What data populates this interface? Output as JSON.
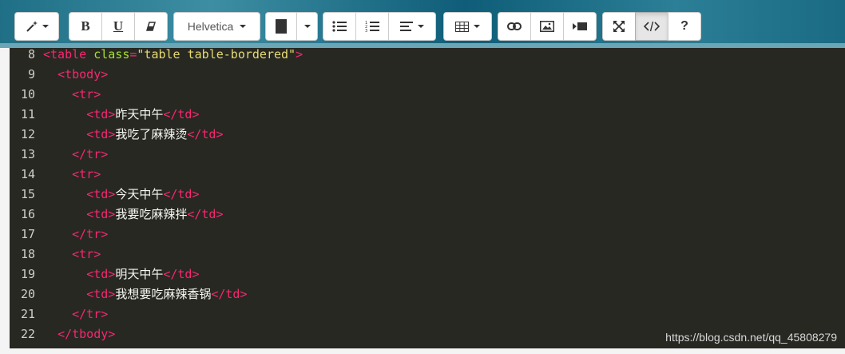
{
  "toolbar": {
    "font_name": "Helvetica",
    "bold_label": "B",
    "underline_label": "U",
    "help_label": "?"
  },
  "editor": {
    "lines": [
      {
        "n": "8",
        "indent": "",
        "parts": [
          {
            "t": "tag",
            "v": "<table "
          },
          {
            "t": "attr",
            "v": "class"
          },
          {
            "t": "tag",
            "v": "="
          },
          {
            "t": "str",
            "v": "\"table table-bordered\""
          },
          {
            "t": "tag",
            "v": ">"
          }
        ]
      },
      {
        "n": "9",
        "indent": "  ",
        "parts": [
          {
            "t": "tag",
            "v": "<tbody>"
          }
        ]
      },
      {
        "n": "10",
        "indent": "    ",
        "parts": [
          {
            "t": "tag",
            "v": "<tr>"
          }
        ]
      },
      {
        "n": "11",
        "indent": "      ",
        "parts": [
          {
            "t": "tag",
            "v": "<td>"
          },
          {
            "t": "txt",
            "v": "昨天中午"
          },
          {
            "t": "tag",
            "v": "</td>"
          }
        ]
      },
      {
        "n": "12",
        "indent": "      ",
        "parts": [
          {
            "t": "tag",
            "v": "<td>"
          },
          {
            "t": "txt",
            "v": "我吃了麻辣烫"
          },
          {
            "t": "tag",
            "v": "</td>"
          }
        ]
      },
      {
        "n": "13",
        "indent": "    ",
        "parts": [
          {
            "t": "tag",
            "v": "</tr>"
          }
        ]
      },
      {
        "n": "14",
        "indent": "    ",
        "parts": [
          {
            "t": "tag",
            "v": "<tr>"
          }
        ]
      },
      {
        "n": "15",
        "indent": "      ",
        "parts": [
          {
            "t": "tag",
            "v": "<td>"
          },
          {
            "t": "txt",
            "v": "今天中午"
          },
          {
            "t": "tag",
            "v": "</td>"
          }
        ]
      },
      {
        "n": "16",
        "indent": "      ",
        "parts": [
          {
            "t": "tag",
            "v": "<td>"
          },
          {
            "t": "txt",
            "v": "我要吃麻辣拌"
          },
          {
            "t": "tag",
            "v": "</td>"
          }
        ]
      },
      {
        "n": "17",
        "indent": "    ",
        "parts": [
          {
            "t": "tag",
            "v": "</tr>"
          }
        ]
      },
      {
        "n": "18",
        "indent": "    ",
        "parts": [
          {
            "t": "tag",
            "v": "<tr>"
          }
        ]
      },
      {
        "n": "19",
        "indent": "      ",
        "parts": [
          {
            "t": "tag",
            "v": "<td>"
          },
          {
            "t": "txt",
            "v": "明天中午"
          },
          {
            "t": "tag",
            "v": "</td>"
          }
        ]
      },
      {
        "n": "20",
        "indent": "      ",
        "parts": [
          {
            "t": "tag",
            "v": "<td>"
          },
          {
            "t": "txt",
            "v": "我想要吃麻辣香锅"
          },
          {
            "t": "tag",
            "v": "</td>"
          }
        ]
      },
      {
        "n": "21",
        "indent": "    ",
        "parts": [
          {
            "t": "tag",
            "v": "</tr>"
          }
        ]
      },
      {
        "n": "22",
        "indent": "  ",
        "parts": [
          {
            "t": "tag",
            "v": "</tbody>"
          }
        ]
      }
    ]
  },
  "watermark": "https://blog.csdn.net/qq_45808279",
  "colors": {
    "tag": "#f92672",
    "attr": "#a6e22e",
    "string": "#e6db74",
    "text": "#f8f8f2",
    "background": "#272822"
  }
}
